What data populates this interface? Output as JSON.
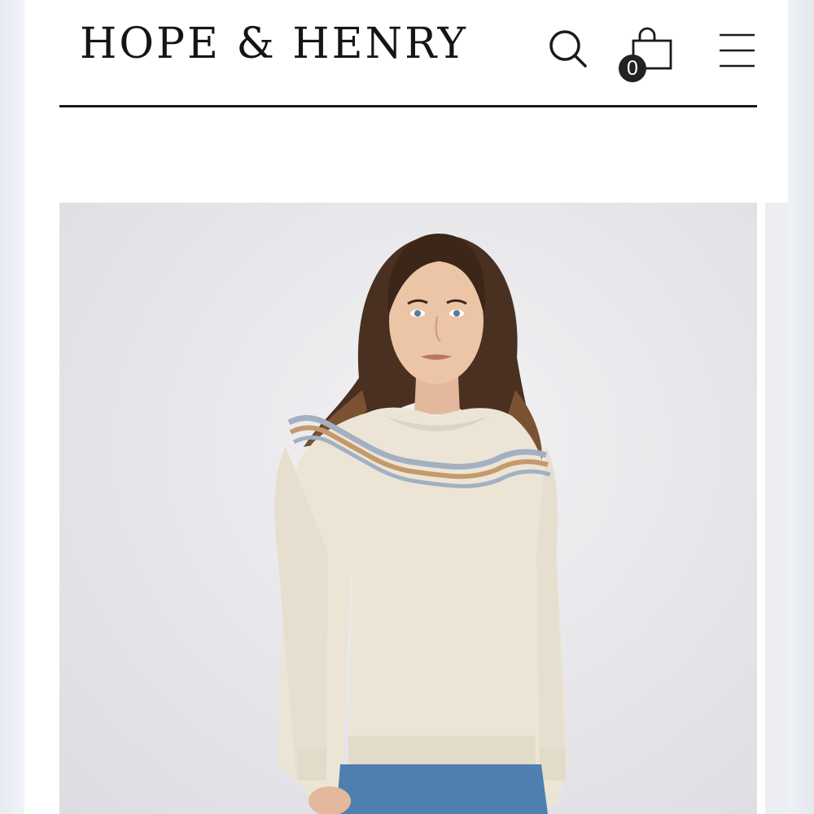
{
  "header": {
    "brand": "HOPE & HENRY",
    "cart_count": "0",
    "icons": {
      "search": "search-icon",
      "cart": "shopping-bag-icon",
      "menu": "hamburger-menu-icon"
    }
  },
  "hero": {
    "image": "product-photo-woman-cream-sweater"
  },
  "colors": {
    "text": "#151515",
    "badge": "#222222",
    "sweater": "#ece5d6",
    "denim": "#4f7fae"
  }
}
